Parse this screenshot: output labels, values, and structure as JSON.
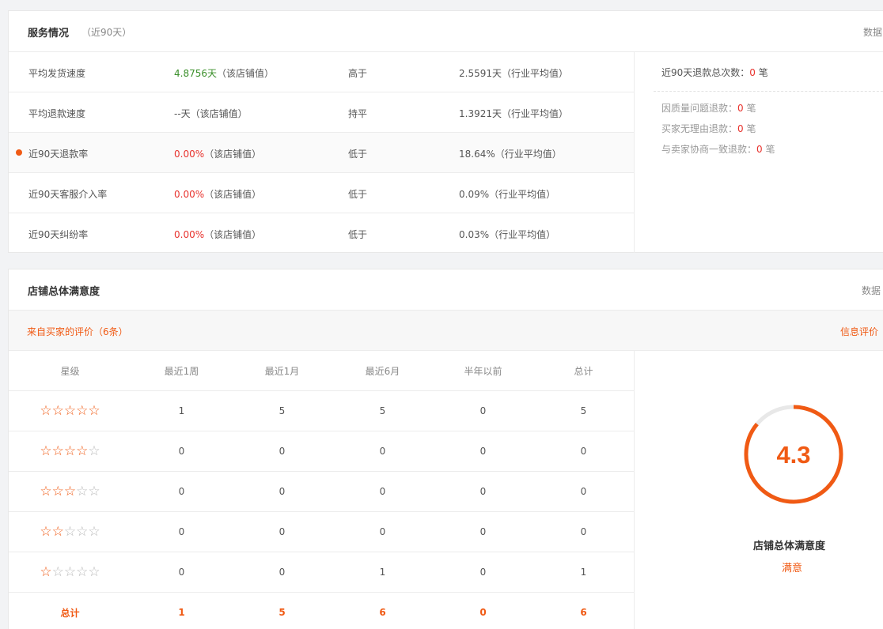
{
  "service": {
    "title": "服务情况",
    "subtitle": "（近90天）",
    "right_text": "数据",
    "metrics": [
      {
        "label": "平均发货速度",
        "value": "4.8756天",
        "value_suffix": "（该店铺值）",
        "compare": "高于",
        "industry": "2.5591天（行业平均值）",
        "value_color": "green"
      },
      {
        "label": "平均退款速度",
        "value": "--天",
        "value_suffix": "（该店铺值）",
        "compare": "持平",
        "industry": "1.3921天（行业平均值）",
        "value_color": "dark"
      },
      {
        "label": "近90天退款率",
        "value": "0.00%",
        "value_suffix": "（该店铺值）",
        "compare": "低于",
        "industry": "18.64%（行业平均值）",
        "value_color": "red"
      },
      {
        "label": "近90天客服介入率",
        "value": "0.00%",
        "value_suffix": "（该店铺值）",
        "compare": "低于",
        "industry": "0.09%（行业平均值）",
        "value_color": "red"
      },
      {
        "label": "近90天纠纷率",
        "value": "0.00%",
        "value_suffix": "（该店铺值）",
        "compare": "低于",
        "industry": "0.03%（行业平均值）",
        "value_color": "red"
      }
    ],
    "refund": {
      "total_label": "近90天退款总次数：",
      "total_value": "0",
      "unit": " 笔",
      "items": [
        {
          "label": "因质量问题退款：",
          "value": "0",
          "unit": " 笔"
        },
        {
          "label": "买家无理由退款：",
          "value": "0",
          "unit": " 笔"
        },
        {
          "label": "与卖家协商一致退款：",
          "value": "0",
          "unit": " 笔"
        }
      ]
    }
  },
  "satisfaction": {
    "title": "店铺总体满意度",
    "right_text": "数据",
    "source_text": "来自买家的评价（6条）",
    "source_right": "信息评价",
    "table": {
      "headers": [
        "星级",
        "最近1周",
        "最近1月",
        "最近6月",
        "半年以前",
        "总计"
      ],
      "rows": [
        {
          "stars": 5,
          "values": [
            "1",
            "5",
            "5",
            "0",
            "5"
          ]
        },
        {
          "stars": 4,
          "values": [
            "0",
            "0",
            "0",
            "0",
            "0"
          ]
        },
        {
          "stars": 3,
          "values": [
            "0",
            "0",
            "0",
            "0",
            "0"
          ]
        },
        {
          "stars": 2,
          "values": [
            "0",
            "0",
            "0",
            "0",
            "0"
          ]
        },
        {
          "stars": 1,
          "values": [
            "0",
            "0",
            "1",
            "0",
            "1"
          ]
        }
      ],
      "total": {
        "label": "总计",
        "values": [
          "1",
          "5",
          "6",
          "0",
          "6"
        ]
      }
    },
    "score": {
      "value": "4.3",
      "fraction": 0.86,
      "label": "店铺总体满意度",
      "level": "满意",
      "ring_color": "#f05a14",
      "track_color": "#e8e8e8"
    }
  }
}
